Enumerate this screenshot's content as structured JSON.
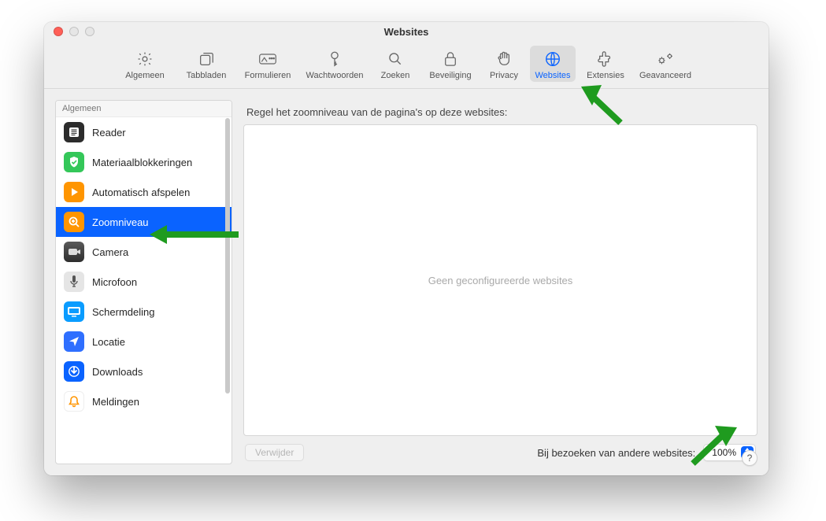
{
  "window": {
    "title": "Websites"
  },
  "toolbar": {
    "items": [
      {
        "label": "Algemeen",
        "icon": "gear"
      },
      {
        "label": "Tabbladen",
        "icon": "tabs"
      },
      {
        "label": "Formulieren",
        "icon": "form"
      },
      {
        "label": "Wachtwoorden",
        "icon": "key"
      },
      {
        "label": "Zoeken",
        "icon": "search"
      },
      {
        "label": "Beveiliging",
        "icon": "lock"
      },
      {
        "label": "Privacy",
        "icon": "hand"
      },
      {
        "label": "Websites",
        "icon": "globe",
        "active": true
      },
      {
        "label": "Extensies",
        "icon": "puzzle"
      },
      {
        "label": "Geavanceerd",
        "icon": "gears"
      }
    ]
  },
  "sidebar": {
    "section_label": "Algemeen",
    "items": [
      {
        "label": "Reader",
        "icon": "reader",
        "iconbg": "#2c2c2c",
        "selected": false
      },
      {
        "label": "Materiaalblokkeringen",
        "icon": "shield",
        "iconbg": "#34c759",
        "selected": false
      },
      {
        "label": "Automatisch afspelen",
        "icon": "play",
        "iconbg": "#ff9500",
        "selected": false
      },
      {
        "label": "Zoomniveau",
        "icon": "zoom",
        "iconbg": "#ff9500",
        "selected": true
      },
      {
        "label": "Camera",
        "icon": "camera",
        "iconbg": "#4a4a4a",
        "selected": false
      },
      {
        "label": "Microfoon",
        "icon": "mic",
        "iconbg": "#d9d9d9",
        "selected": false
      },
      {
        "label": "Schermdeling",
        "icon": "screenshare",
        "iconbg": "#0a84ff",
        "selected": false
      },
      {
        "label": "Locatie",
        "icon": "location",
        "iconbg": "#0a63ff",
        "selected": false
      },
      {
        "label": "Downloads",
        "icon": "download",
        "iconbg": "#0a63ff",
        "selected": false
      },
      {
        "label": "Meldingen",
        "icon": "bell",
        "iconbg": "#ffffff",
        "selected": false
      }
    ]
  },
  "main": {
    "header": "Regel het zoomniveau van de pagina's op deze websites:",
    "empty_text": "Geen geconfigureerde websites",
    "remove_button": "Verwijder",
    "other_sites_label": "Bij bezoeken van andere websites:",
    "zoom_value": "100%"
  },
  "help": {
    "label": "?"
  }
}
